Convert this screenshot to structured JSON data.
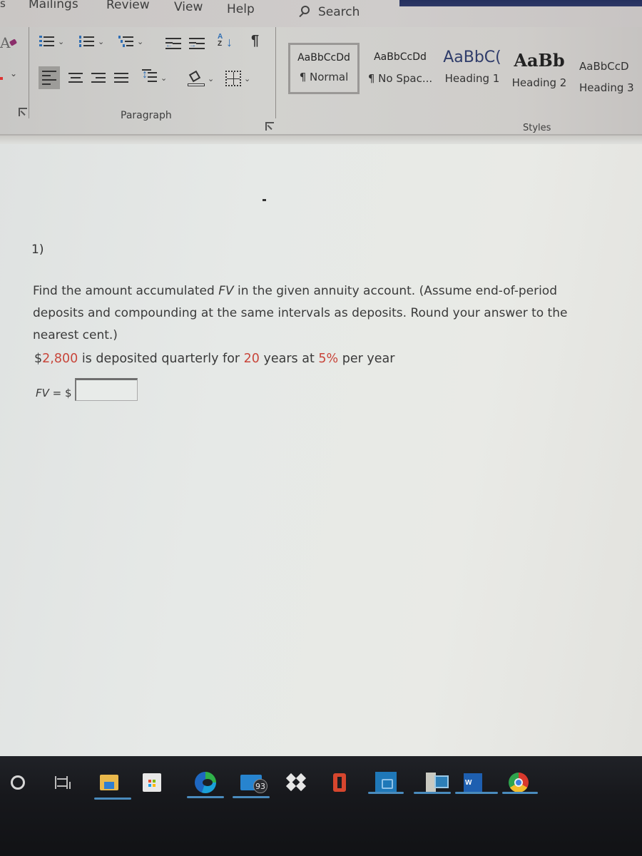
{
  "ribbon_tabs": {
    "partial_left": "s",
    "mailings": "Mailings",
    "review": "Review",
    "view": "View",
    "help": "Help",
    "search_label": "Search"
  },
  "ribbon": {
    "paragraph_group_label": "Paragraph",
    "styles_group_label": "Styles",
    "paragraph_buttons": [
      "bullets",
      "numbering",
      "multilevel-list",
      "decrease-indent",
      "increase-indent",
      "sort",
      "show-hide-marks",
      "align-left",
      "center",
      "align-right",
      "justify",
      "line-spacing",
      "shading",
      "borders"
    ],
    "styles": [
      {
        "preview": "AaBbCcDd",
        "name": "¶ Normal",
        "selected": true
      },
      {
        "preview": "AaBbCcDd",
        "name": "¶ No Spac...",
        "selected": false
      },
      {
        "preview": "AaBbC(",
        "name": "Heading 1",
        "selected": false
      },
      {
        "preview": "AaBb",
        "name": "Heading 2",
        "selected": false
      },
      {
        "preview": "AaBbCcD",
        "name": "Heading 3",
        "selected": false
      }
    ]
  },
  "document": {
    "question_number": "1)",
    "instructions": {
      "line1_pre": "Find the amount accumulated ",
      "line1_var": "FV",
      "line1_post": " in the given annuity account. (Assume end-of-period",
      "line2": "deposits and compounding at the same intervals as deposits. Round your answer to the",
      "line3": "nearest cent.)"
    },
    "given": {
      "dollar": "$",
      "deposit": "2,800",
      "text1": " is deposited quarterly for ",
      "years": "20",
      "text2": " years at ",
      "rate": "5%",
      "text3": " per year"
    },
    "answer": {
      "label_var": "FV",
      "label_rest": " = $",
      "value": ""
    },
    "highlight_color": "#c8453a"
  },
  "taskbar": {
    "items": [
      {
        "name": "Cortana",
        "active": false
      },
      {
        "name": "Task View",
        "active": false
      },
      {
        "name": "File Explorer",
        "active": true
      },
      {
        "name": "Microsoft Store",
        "active": false
      },
      {
        "name": "Microsoft Edge",
        "active": true
      },
      {
        "name": "Mail",
        "active": true,
        "badge": "93"
      },
      {
        "name": "Dropbox",
        "active": false
      },
      {
        "name": "Office",
        "active": false
      },
      {
        "name": "App",
        "active": true
      },
      {
        "name": "Your Phone",
        "active": true
      },
      {
        "name": "Word",
        "active": true,
        "label": "W"
      },
      {
        "name": "Google Chrome",
        "active": true
      }
    ]
  }
}
